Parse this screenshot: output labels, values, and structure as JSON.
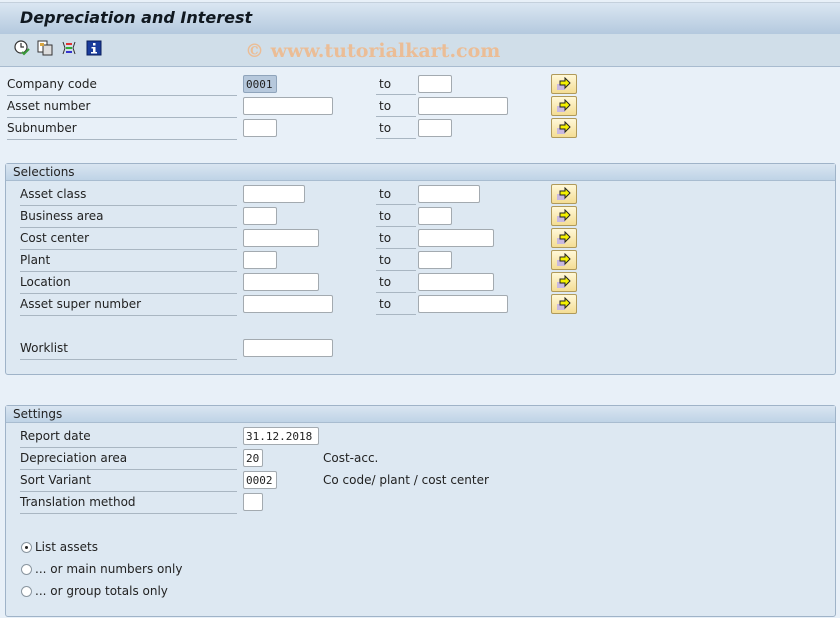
{
  "title": "Depreciation and Interest",
  "watermark": "© www.tutorialkart.com",
  "toolbar": {
    "icons": [
      "execute-icon",
      "copy-icon",
      "selection-options-icon",
      "info-icon"
    ]
  },
  "to_label": "to",
  "top_fields": [
    {
      "label": "Company code",
      "value": "0001",
      "to_value": ""
    },
    {
      "label": "Asset number",
      "value": "",
      "to_value": ""
    },
    {
      "label": "Subnumber",
      "value": "",
      "to_value": ""
    }
  ],
  "selections": {
    "title": "Selections",
    "fields": [
      {
        "label": "Asset class",
        "value": "",
        "to_value": ""
      },
      {
        "label": "Business area",
        "value": "",
        "to_value": ""
      },
      {
        "label": "Cost center",
        "value": "",
        "to_value": ""
      },
      {
        "label": "Plant",
        "value": "",
        "to_value": ""
      },
      {
        "label": "Location",
        "value": "",
        "to_value": ""
      },
      {
        "label": "Asset super number",
        "value": "",
        "to_value": ""
      }
    ],
    "worklist": {
      "label": "Worklist",
      "value": ""
    }
  },
  "settings": {
    "title": "Settings",
    "fields": [
      {
        "label": "Report date",
        "value": "31.12.2018",
        "desc": ""
      },
      {
        "label": "Depreciation area",
        "value": "20",
        "desc": "Cost-acc."
      },
      {
        "label": "Sort Variant",
        "value": "0002",
        "desc": "Co code/ plant / cost center"
      },
      {
        "label": "Translation method",
        "value": "",
        "desc": ""
      }
    ],
    "radios": [
      {
        "label": "List assets",
        "selected": true
      },
      {
        "label": "... or main numbers only",
        "selected": false
      },
      {
        "label": "... or group totals only",
        "selected": false
      }
    ]
  }
}
